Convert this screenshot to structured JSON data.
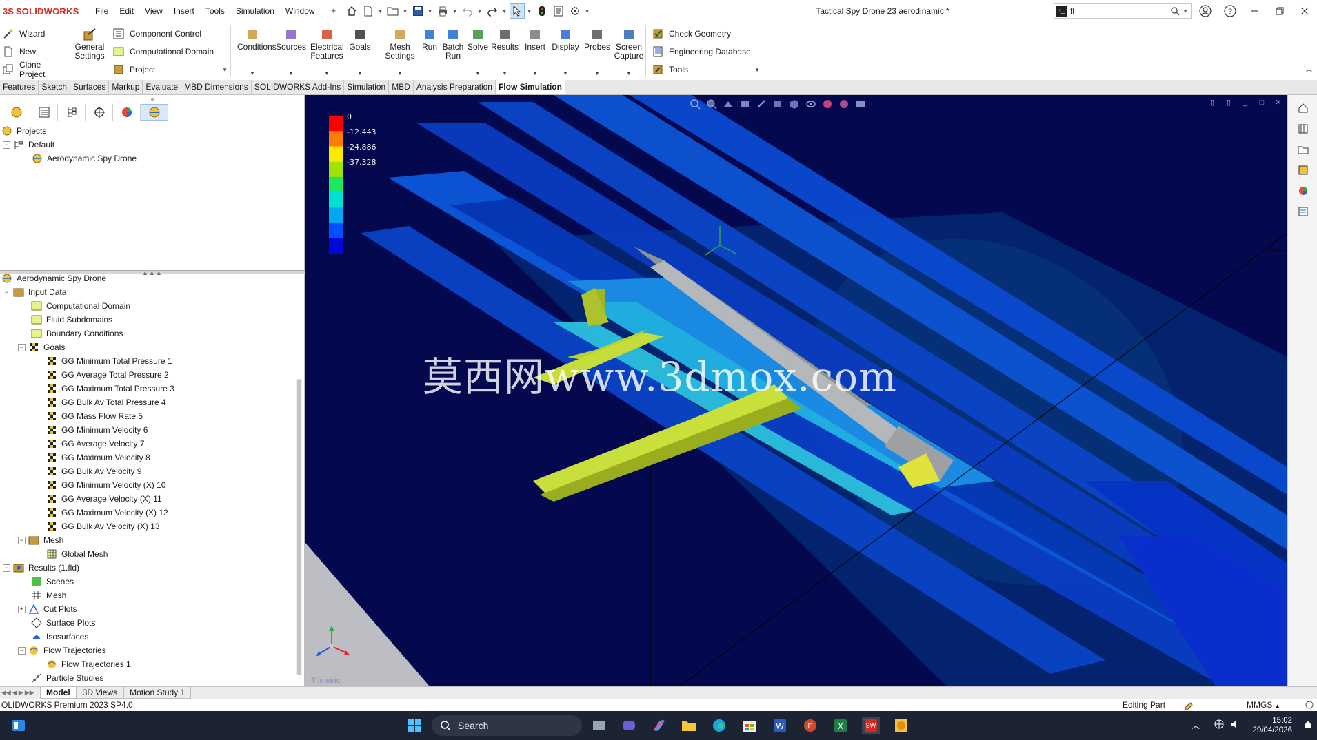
{
  "app": {
    "brand_prefix": "3S",
    "brand_name": "SOLIDWORKS",
    "menu": [
      "File",
      "Edit",
      "View",
      "Insert",
      "Tools",
      "Simulation",
      "Window"
    ],
    "document_title": "Tactical Spy Drone 23 aerodinamic *",
    "search_value": "fl"
  },
  "ribbon": {
    "left": [
      "Wizard",
      "New",
      "Clone Project"
    ],
    "general_settings": "General\nSettings",
    "mid": [
      "Component Control",
      "Computational Domain",
      "Project"
    ],
    "big": [
      {
        "label": "Conditions"
      },
      {
        "label": "Sources"
      },
      {
        "label": "Electrical\nFeatures"
      },
      {
        "label": "Goals"
      },
      {
        "label": "Mesh\nSettings"
      },
      {
        "label": "Run"
      },
      {
        "label": "Batch\nRun"
      },
      {
        "label": "Solve"
      },
      {
        "label": "Results"
      },
      {
        "label": "Insert"
      },
      {
        "label": "Display"
      },
      {
        "label": "Probes"
      },
      {
        "label": "Screen\nCapture"
      }
    ],
    "right": [
      "Check Geometry",
      "Engineering Database",
      "Tools"
    ]
  },
  "tabs": [
    "Features",
    "Sketch",
    "Surfaces",
    "Markup",
    "Evaluate",
    "MBD Dimensions",
    "SOLIDWORKS Add-Ins",
    "Simulation",
    "MBD",
    "Analysis Preparation",
    "Flow Simulation"
  ],
  "active_tab": "Flow Simulation",
  "projects_tree": {
    "root": "Projects",
    "config": "Default",
    "project": "Aerodynamic Spy Drone"
  },
  "analysis_tree": {
    "root": "Aerodynamic Spy Drone",
    "input_data": "Input Data",
    "input_children": [
      "Computational Domain",
      "Fluid Subdomains",
      "Boundary Conditions"
    ],
    "goals_label": "Goals",
    "goals": [
      "GG Minimum Total Pressure 1",
      "GG Average Total Pressure 2",
      "GG Maximum Total Pressure 3",
      "GG Bulk Av Total Pressure 4",
      "GG Mass Flow Rate 5",
      "GG Minimum Velocity 6",
      "GG Average Velocity 7",
      "GG Maximum Velocity 8",
      "GG Bulk Av Velocity 9",
      "GG Minimum Velocity (X) 10",
      "GG Average Velocity (X) 11",
      "GG Maximum Velocity (X) 12",
      "GG Bulk Av Velocity (X) 13"
    ],
    "mesh_label": "Mesh",
    "global_mesh": "Global Mesh",
    "results_label": "Results (1.fld)",
    "results_children": [
      "Scenes",
      "Mesh",
      "Cut Plots",
      "Surface Plots",
      "Isosurfaces"
    ],
    "flow_trajectories": "Flow Trajectories",
    "flow_trajectories_1": "Flow Trajectories 1",
    "particle_studies": "Particle Studies"
  },
  "legend": {
    "labels": [
      "0",
      "-12.443",
      "-24.886",
      "-37.328"
    ],
    "colors": [
      "#ff0000",
      "#ff7a00",
      "#ffe800",
      "#9ee400",
      "#1ee860",
      "#00e0d8",
      "#00a8f0",
      "#0050ff",
      "#0008d8"
    ]
  },
  "watermark": "莫西网www.3dmox.com",
  "viewport_label": "Trimetric",
  "bottom_tabs": [
    "Model",
    "3D Views",
    "Motion Study 1"
  ],
  "status": {
    "left": "OLIDWORKS Premium 2023 SP4.0",
    "editing": "Editing Part",
    "units": "MMGS"
  },
  "taskbar": {
    "search": "Search",
    "time": "15:02",
    "date": "29/04/2026"
  },
  "colors": {
    "viewport_bg": "#04084f",
    "accent": "#d52b1e"
  }
}
